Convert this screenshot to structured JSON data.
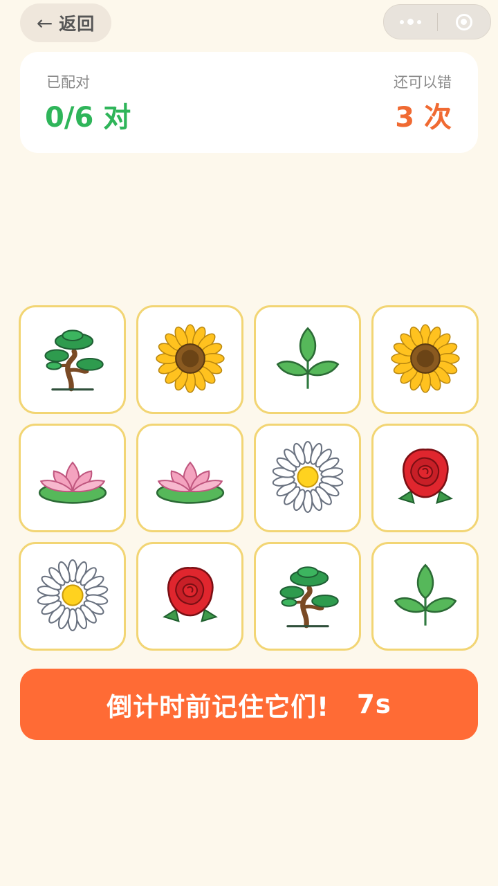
{
  "nav": {
    "back_arrow": "←",
    "back_label": "返回"
  },
  "capsule": {
    "more_icon": "more-dots-icon",
    "close_icon": "target-close-icon"
  },
  "score": {
    "matched_label": "已配对",
    "matched_value": "0/6 对",
    "mistakes_label": "还可以错",
    "mistakes_value": "3 次"
  },
  "cards": [
    {
      "plant": "bonsai"
    },
    {
      "plant": "sunflower"
    },
    {
      "plant": "sprout"
    },
    {
      "plant": "sunflower"
    },
    {
      "plant": "lotus"
    },
    {
      "plant": "lotus"
    },
    {
      "plant": "daisy"
    },
    {
      "plant": "rose"
    },
    {
      "plant": "daisy"
    },
    {
      "plant": "rose"
    },
    {
      "plant": "bonsai"
    },
    {
      "plant": "sprout"
    }
  ],
  "timer": {
    "message": "倒计时前记住它们!",
    "seconds": "7s"
  },
  "colors": {
    "background": "#fdf8ec",
    "matched": "#2fb55a",
    "mistakes": "#f06a32",
    "timer_bar": "#ff6b35",
    "card_border": "#f2d574"
  }
}
